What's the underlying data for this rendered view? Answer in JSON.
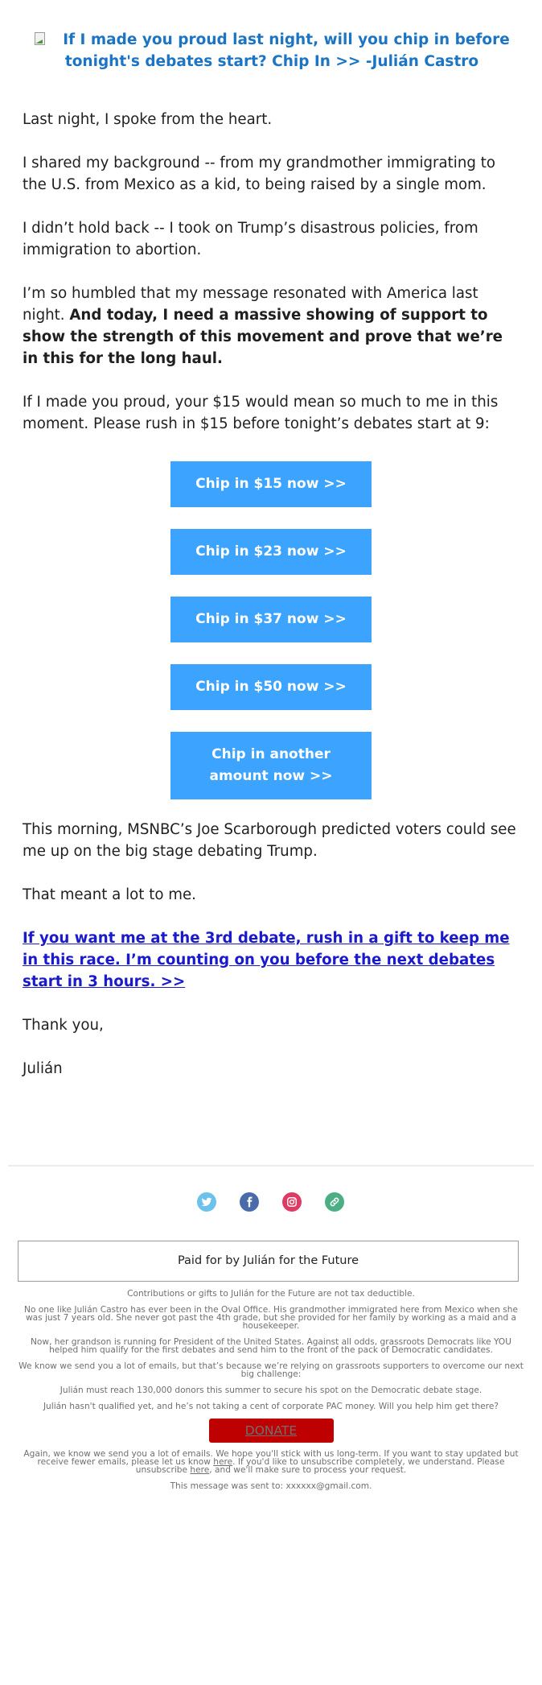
{
  "header": {
    "image_alt": "broken-image",
    "title": "If I made you proud last night, will you chip in before tonight's debates start? Chip In >> -Julián Castro"
  },
  "body_top": {
    "p1": "Last night, I spoke from the heart.",
    "p2": "I shared my background -- from my grandmother immigrating to the U.S. from Mexico as a kid, to being raised by a single mom.",
    "p3": "I didn’t hold back -- I took on Trump’s disastrous policies, from immigration to abortion.",
    "p4_plain": "I’m so humbled that my message resonated with America last night. ",
    "p4_bold": "And today, I need a massive showing of support to show the strength of this movement and prove that we’re in this for the long haul.",
    "p5": "If I made you proud, your $15 would mean so much to me in this moment. Please rush in $15 before tonight’s debates start at 9:"
  },
  "donation_buttons": [
    {
      "label": "Chip in $15 now >>",
      "amount": "$15"
    },
    {
      "label": "Chip in $23 now >>",
      "amount": "$23"
    },
    {
      "label": "Chip in $37 now >>",
      "amount": "$37"
    },
    {
      "label": "Chip in $50 now >>",
      "amount": "$50"
    },
    {
      "label": "Chip in another amount now >>",
      "amount": "other"
    }
  ],
  "body_bottom": {
    "p1": "This morning, MSNBC’s Joe Scarborough predicted voters could see me up on the big stage debating Trump.",
    "p2": "That meant a lot to me.",
    "cta_link": "If you want me at the 3rd debate, rush in a gift to keep me in this race. I’m counting on you before the next debates start in 3 hours. >>",
    "signoff": "Thank you,",
    "signature": "Julián"
  },
  "social": [
    {
      "name": "twitter",
      "icon": "twitter-icon",
      "color": "#6cc2ea"
    },
    {
      "name": "facebook",
      "icon": "facebook-icon",
      "color": "#4a6aaa"
    },
    {
      "name": "instagram",
      "icon": "instagram-icon",
      "color": "#de3a63"
    },
    {
      "name": "website",
      "icon": "link-icon",
      "color": "#4cae84"
    }
  ],
  "footer": {
    "paid_for": "Paid for by Julián for the Future",
    "tax": "Contributions or gifts to Julián for the Future are not tax deductible.",
    "bio": "No one like Julián Castro has ever been in the Oval Office. His grandmother immigrated here from Mexico when she was just 7 years old. She never got past the 4th grade, but she provided for her family by working as a maid and a housekeeper.",
    "grandson": "Now, her grandson is running for President of the United States. Against all odds, grassroots Democrats like YOU helped him qualify for the first debates and send him to the front of the pack of Democratic candidates.",
    "emails": "We know we send you a lot of emails, but that’s because we’re relying on grassroots supporters to overcome our next big challenge:",
    "donors": "Julián must reach 130,000 donors this summer to secure his spot on the Democratic debate stage.",
    "pac": "Julián hasn't qualified yet, and he’s not taking a cent of corporate PAC money. Will you help him get there?",
    "donate_label": "DONATE",
    "again_part1": "Again, we know we send you a lot of emails. We hope you'll stick with us long-term. If you want to stay updated but receive fewer emails, please let us know ",
    "here1": "here",
    "again_part2": ". If you'd like to unsubscribe completely, we understand. Please unsubscribe ",
    "here2": "here",
    "again_part3": ", and we'll make sure to process your request.",
    "sent_to": "This message was sent to: xxxxxx@gmail.com."
  },
  "colors": {
    "header_blue": "#1b75c4",
    "button_blue": "#3ca3ff",
    "link_blue": "#1a1acc",
    "donate_red": "#bf0000"
  }
}
